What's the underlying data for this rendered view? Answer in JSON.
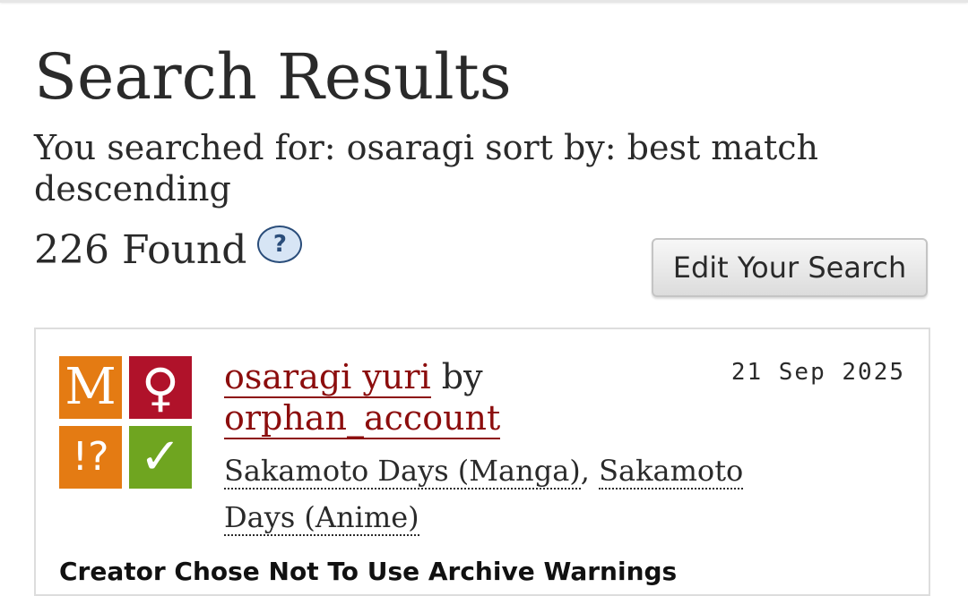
{
  "header": {
    "title": "Search Results",
    "search_summary": "You searched for: osaragi sort by: best match descending",
    "found_count": "226 Found",
    "help_label": "?",
    "edit_search_label": "Edit Your Search"
  },
  "results": [
    {
      "icons": {
        "rating": "M",
        "category": "♀",
        "warning": "!?",
        "complete": "✓"
      },
      "icon_colors": {
        "rating": "#e47b13",
        "category": "#b0122a",
        "warning": "#e47b13",
        "complete": "#6fa520"
      },
      "title": "osaragi yuri",
      "by": "by",
      "author": "orphan_account",
      "date": "21 Sep 2025",
      "fandoms": [
        "Sakamoto Days (Manga)",
        "Sakamoto Days (Anime)"
      ],
      "fandom_separator": ",",
      "warning_text": "Creator Chose Not To Use Archive Warnings"
    }
  ],
  "colors": {
    "link": "#8c0d0d",
    "help_bg": "#d7e5f5",
    "help_border": "#2a4d7a"
  }
}
